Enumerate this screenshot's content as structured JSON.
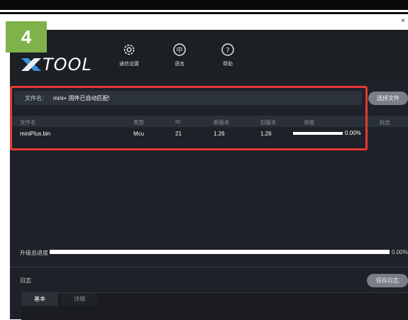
{
  "step_badge": "4",
  "logo": {
    "text": "TOOL"
  },
  "nav": [
    {
      "label": "通信设置",
      "icon": "gear-icon"
    },
    {
      "label": "语言",
      "icon": "language-icon",
      "glyph": "中"
    },
    {
      "label": "帮助",
      "icon": "help-icon",
      "glyph": "?"
    }
  ],
  "firmware": {
    "label": "文件名:",
    "message": "mini+ 固件已自动匹配!"
  },
  "select_file_button": "选择文件",
  "table": {
    "headers": [
      "文件名",
      "类型",
      "ID",
      "新版本",
      "旧版本",
      "进度",
      "标志"
    ],
    "rows": [
      {
        "file": "miniPlus.bin",
        "type": "Mcu",
        "id": "21",
        "new_version": "1.26",
        "old_version": "1.26",
        "progress_text": "0.00%"
      }
    ]
  },
  "total_progress": {
    "label": "升级总进度",
    "value": "0.00%"
  },
  "log": {
    "label": "日志",
    "save_button": "保存日志",
    "tabs": [
      "基本",
      "详细"
    ]
  },
  "colors": {
    "badge": "#7fb24a",
    "highlight": "#e53935",
    "background": "#1e2127"
  }
}
